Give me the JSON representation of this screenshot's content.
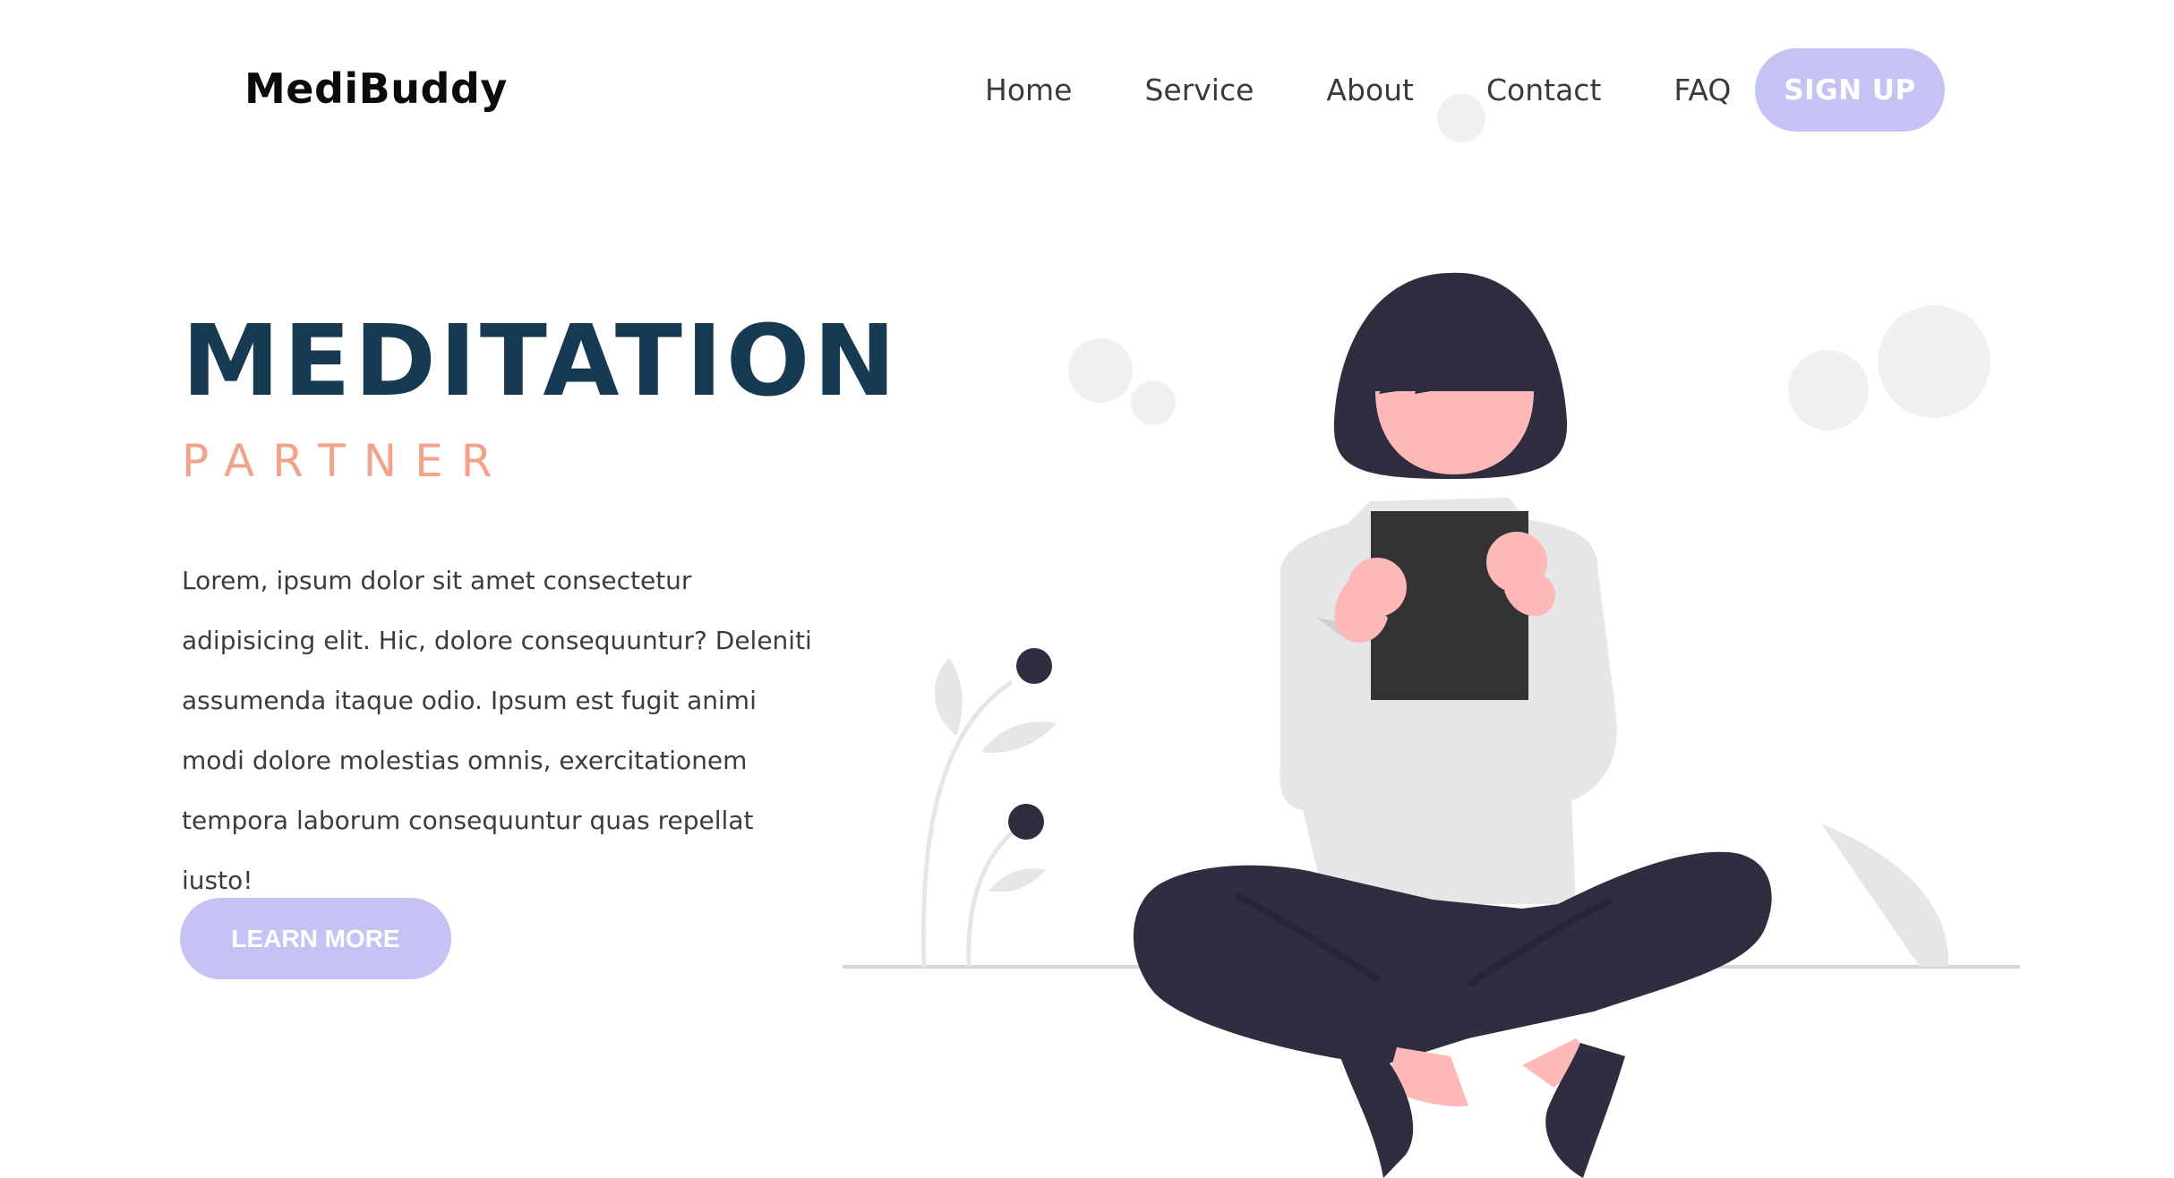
{
  "header": {
    "logo": "MediBuddy",
    "nav": [
      "Home",
      "Service",
      "About",
      "Contact",
      "FAQ"
    ],
    "signup_label": "SIGN UP"
  },
  "hero": {
    "title": "MEDITATION",
    "subtitle": "PARTNER",
    "body": "Lorem, ipsum dolor sit amet consectetur adipisicing elit. Hic, dolore consequuntur? Deleniti assumenda itaque odio. Ipsum est fugit animi modi dolore molestias omnis, exercitationem tempora laborum consequuntur quas repellat iusto!",
    "cta_label": "LEARN MORE"
  },
  "colors": {
    "accent": "#c5c3f4",
    "title": "#163a52",
    "subtitle": "#f2a48a",
    "figure_dark": "#2f2e41",
    "skin": "#ffb8b8",
    "shirt": "#e6e6e6"
  },
  "illustration": {
    "name": "meditating-woman-reading-illustration"
  }
}
